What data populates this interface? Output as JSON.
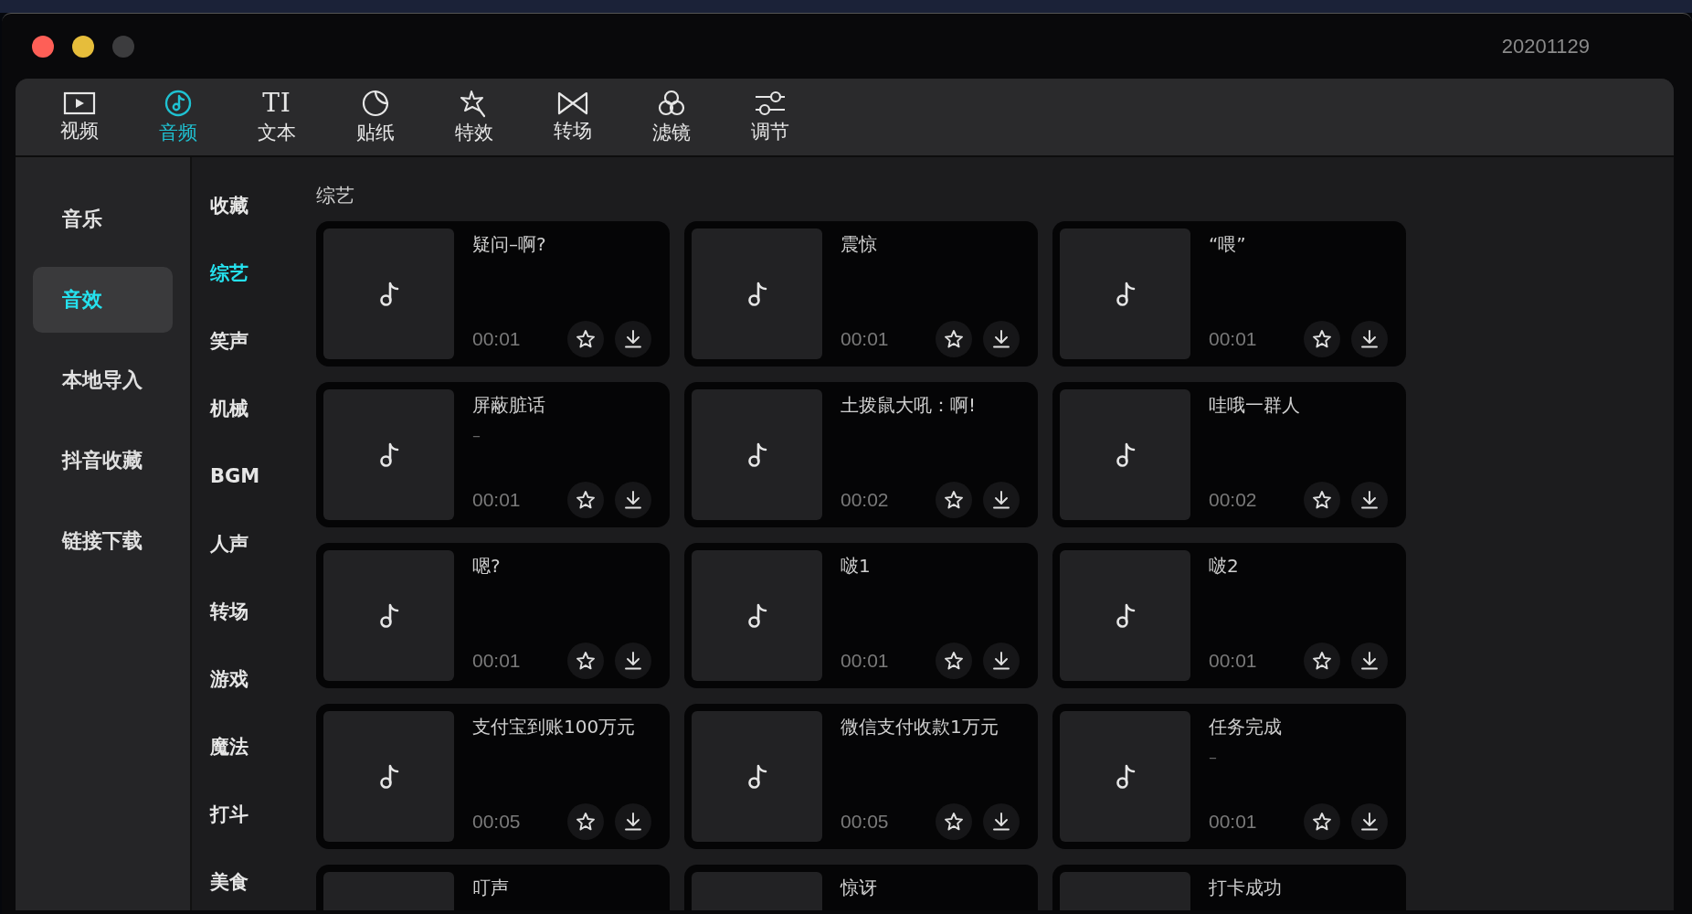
{
  "window": {
    "version": "20201129"
  },
  "tabs": [
    {
      "label": "视频",
      "kind": "video",
      "selected": false
    },
    {
      "label": "音频",
      "kind": "audio",
      "selected": true
    },
    {
      "label": "文本",
      "kind": "text",
      "glyph": "TI",
      "selected": false
    },
    {
      "label": "贴纸",
      "kind": "sticker",
      "selected": false
    },
    {
      "label": "特效",
      "kind": "effects",
      "selected": false
    },
    {
      "label": "转场",
      "kind": "transition",
      "selected": false
    },
    {
      "label": "滤镜",
      "kind": "filter",
      "selected": false
    },
    {
      "label": "调节",
      "kind": "adjust",
      "selected": false
    }
  ],
  "sidebar": {
    "items": [
      {
        "label": "音乐",
        "selected": false
      },
      {
        "label": "音效",
        "selected": true
      },
      {
        "label": "本地导入",
        "selected": false
      },
      {
        "label": "抖音收藏",
        "selected": false
      },
      {
        "label": "链接下载",
        "selected": false
      }
    ]
  },
  "categories": [
    {
      "label": "收藏",
      "selected": false
    },
    {
      "label": "综艺",
      "selected": true
    },
    {
      "label": "笑声",
      "selected": false
    },
    {
      "label": "机械",
      "selected": false
    },
    {
      "label": "BGM",
      "selected": false
    },
    {
      "label": "人声",
      "selected": false
    },
    {
      "label": "转场",
      "selected": false
    },
    {
      "label": "游戏",
      "selected": false
    },
    {
      "label": "魔法",
      "selected": false
    },
    {
      "label": "打斗",
      "selected": false
    },
    {
      "label": "美食",
      "selected": false
    }
  ],
  "section_title": "综艺",
  "sounds": [
    {
      "title": "疑问–啊?",
      "duration": "00:01"
    },
    {
      "title": "震惊",
      "duration": "00:01"
    },
    {
      "title": "“喂”",
      "duration": "00:01"
    },
    {
      "title": "屏蔽脏话",
      "subtitle": "–",
      "duration": "00:01"
    },
    {
      "title": "土拨鼠大吼：啊!",
      "duration": "00:02"
    },
    {
      "title": "哇哦一群人",
      "duration": "00:02"
    },
    {
      "title": "嗯?",
      "duration": "00:01"
    },
    {
      "title": "啵1",
      "duration": "00:01"
    },
    {
      "title": "啵2",
      "duration": "00:01"
    },
    {
      "title": "支付宝到账100万元",
      "duration": "00:05"
    },
    {
      "title": "微信支付收款1万元",
      "duration": "00:05"
    },
    {
      "title": "任务完成",
      "subtitle": "–",
      "duration": "00:01"
    },
    {
      "title": "叮声"
    },
    {
      "title": "惊讶"
    },
    {
      "title": "打卡成功"
    }
  ]
}
